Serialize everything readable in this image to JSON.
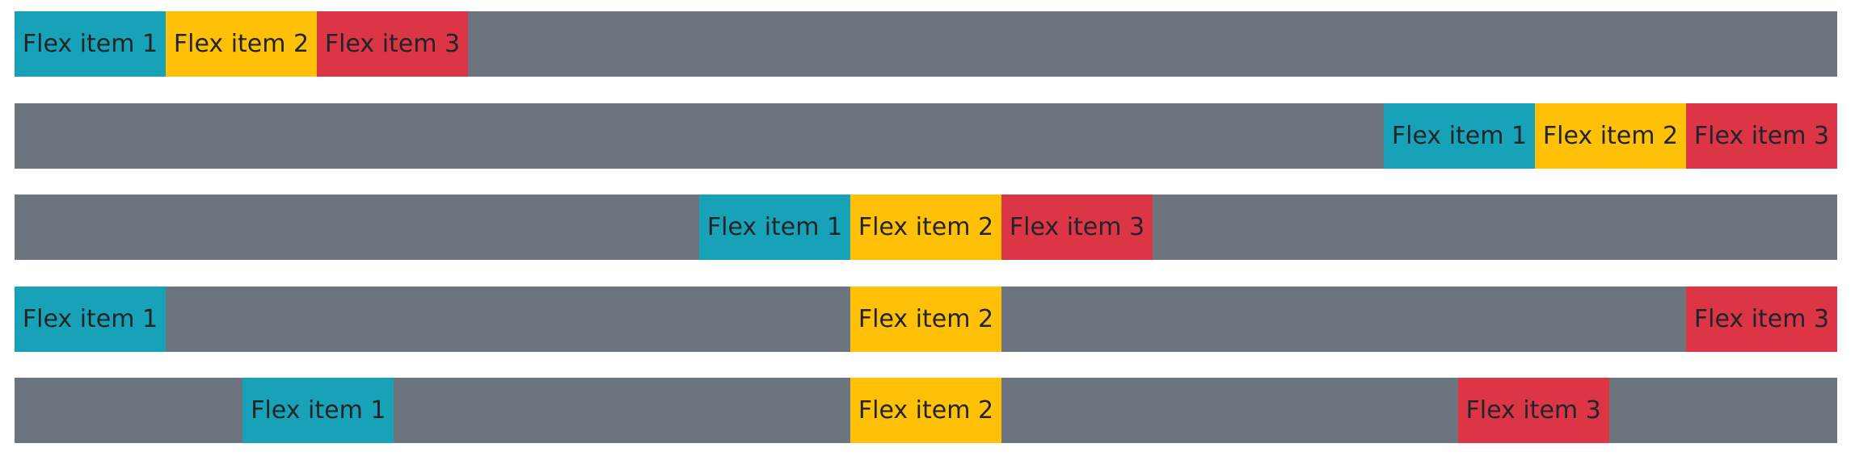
{
  "rows": [
    {
      "justify": "flex-start",
      "items": [
        "Flex item 1",
        "Flex item 2",
        "Flex item 3"
      ]
    },
    {
      "justify": "flex-end",
      "items": [
        "Flex item 1",
        "Flex item 2",
        "Flex item 3"
      ]
    },
    {
      "justify": "center",
      "items": [
        "Flex item 1",
        "Flex item 2",
        "Flex item 3"
      ]
    },
    {
      "justify": "space-between",
      "items": [
        "Flex item 1",
        "Flex item 2",
        "Flex item 3"
      ]
    },
    {
      "justify": "space-around",
      "items": [
        "Flex item 1",
        "Flex item 2",
        "Flex item 3"
      ]
    }
  ],
  "colors": {
    "container": "#6c757d",
    "item_1": "#17a2b8",
    "item_2": "#ffc107",
    "item_3": "#dc3545",
    "text": "#212529"
  }
}
